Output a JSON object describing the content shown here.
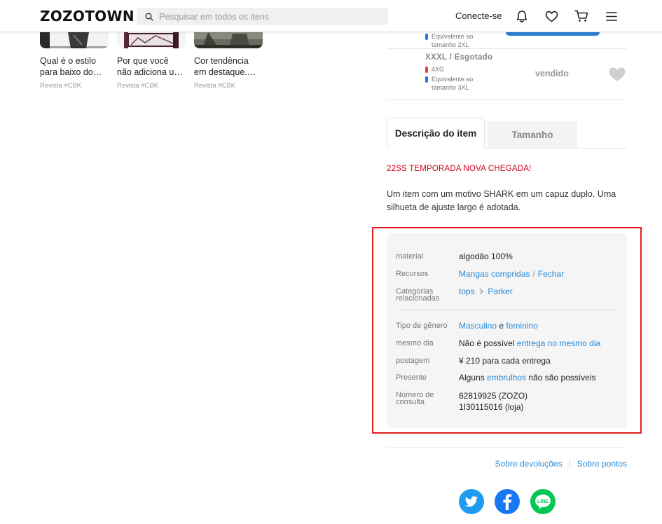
{
  "header": {
    "logo": "ZOZOTOWN",
    "search_placeholder": "Pesquisar em todos os itens",
    "login_label": "Conecte-se"
  },
  "articles": [
    {
      "title_line1": "Qual é o estilo",
      "title_line2": "para baixo do…",
      "tag": "Revista #CBK"
    },
    {
      "title_line1": "Por que você",
      "title_line2": "não adiciona u…",
      "tag": "Revista #CBK"
    },
    {
      "title_line1": "Cor tendência",
      "title_line2": "em destaque.…",
      "tag": "Revista #CBK"
    }
  ],
  "sizes": [
    {
      "equiv_line1": "Equivalente ao",
      "equiv_line2": "tamanho 2XL"
    },
    {
      "label": "XXXL /  Esgotado",
      "women_size": "4XG",
      "equiv_line1": "Equivalente ao",
      "equiv_line2": "tamanho 3XL",
      "status": "vendido"
    }
  ],
  "tabs": [
    {
      "label": "Descrição do item",
      "active": true
    },
    {
      "label": "Tamanho",
      "active": false
    }
  ],
  "promo_text": "22SS TEMPORADA NOVA CHEGADA!",
  "description": "Um item com um motivo SHARK em um capuz duplo. Uma silhueta de ajuste largo é adotada.",
  "specs": {
    "material_label": "material",
    "material_value": "algodão 100%",
    "features_label": "Recursos",
    "features_link1": "Mangas compridas",
    "features_sep": "/",
    "features_link2": "Fechar",
    "categories_label_line1": "Categorias",
    "categories_label_line2": "relacionadas",
    "category_link1": "tops",
    "category_link2": "Parker",
    "gender_label": "Tipo de gênero",
    "gender_link1": "Masculino",
    "gender_and": "e",
    "gender_link2": "feminino",
    "sameday_label": "mesmo dia",
    "sameday_text": "Não é possível",
    "sameday_link": "entrega no mesmo dia",
    "shipping_label": "postagem",
    "shipping_value": "¥ 210 para cada entrega",
    "gift_label": "Presente",
    "gift_prefix": "Alguns",
    "gift_link": "embrulhos",
    "gift_suffix": "não são possíveis",
    "inquiry_label_line1": "Número de",
    "inquiry_label_line2": "consulta",
    "inquiry_value1": "62819925 (ZOZO)",
    "inquiry_value2": "1I30115016 (loja)"
  },
  "footer": {
    "returns_link": "Sobre devoluções",
    "points_link": "Sobre pontos"
  },
  "social": {
    "line_label": "LINE"
  },
  "colors": {
    "link": "#2b8ad6",
    "promo": "#d0021b",
    "highlight_border": "#e01b1b",
    "twitter": "#1d9bf0",
    "facebook": "#1877f2",
    "line": "#06c755"
  }
}
